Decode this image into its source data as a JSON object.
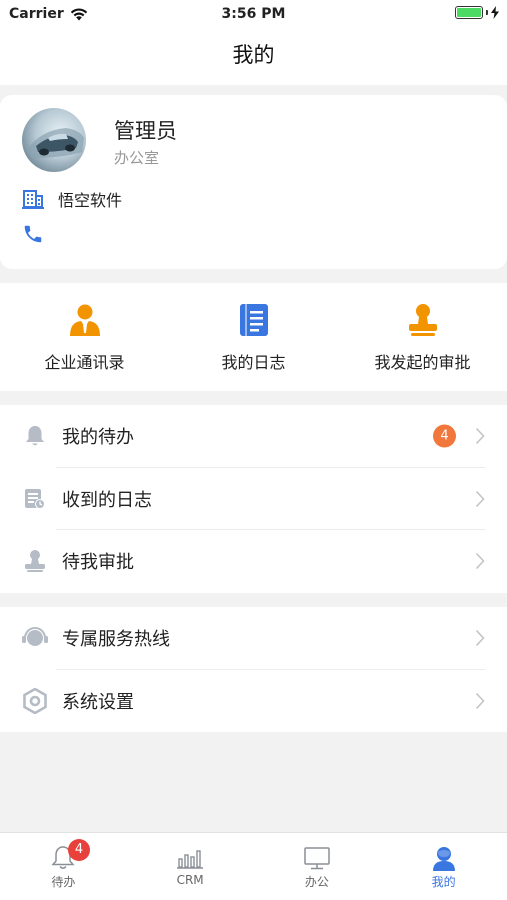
{
  "status_bar": {
    "carrier": "Carrier",
    "time": "3:56 PM"
  },
  "nav": {
    "title": "我的"
  },
  "profile": {
    "name": "管理员",
    "department": "办公室",
    "company": "悟空软件",
    "phone": ""
  },
  "quick_actions": [
    {
      "label": "企业通讯录",
      "icon": "contacts-icon"
    },
    {
      "label": "我的日志",
      "icon": "journal-icon"
    },
    {
      "label": "我发起的审批",
      "icon": "approval-stamp-icon"
    }
  ],
  "menu_group_1": [
    {
      "label": "我的待办",
      "icon": "bell-icon",
      "badge": "4"
    },
    {
      "label": "收到的日志",
      "icon": "received-log-icon"
    },
    {
      "label": "待我审批",
      "icon": "stamp-icon"
    }
  ],
  "menu_group_2": [
    {
      "label": "专属服务热线",
      "icon": "headset-icon"
    },
    {
      "label": "系统设置",
      "icon": "settings-hexagon-icon"
    }
  ],
  "tab_bar": {
    "tabs": [
      {
        "label": "待办",
        "icon": "bell-icon",
        "badge": "4"
      },
      {
        "label": "CRM",
        "icon": "bar-chart-icon"
      },
      {
        "label": "办公",
        "icon": "monitor-icon"
      },
      {
        "label": "我的",
        "icon": "user-icon",
        "active": true
      }
    ]
  },
  "colors": {
    "accent_blue": "#3a76e0",
    "orange": "#f29400",
    "badge_orange": "#f2773d",
    "badge_red": "#e8413c",
    "battery_green": "#4cd964"
  }
}
